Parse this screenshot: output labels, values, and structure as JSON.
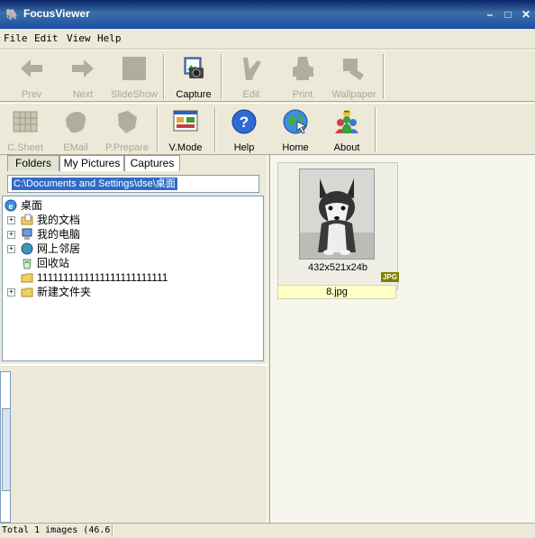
{
  "window": {
    "title": "FocusViewer",
    "min_label": "–",
    "max_label": "□",
    "close_label": "✕"
  },
  "menu": [
    "File",
    "Edit",
    "View",
    "Help"
  ],
  "toolbar1": [
    {
      "label": "Prev",
      "icon": "arrow-left-icon",
      "enabled": false
    },
    {
      "label": "Next",
      "icon": "arrow-right-icon",
      "enabled": false
    },
    {
      "label": "SlideShow",
      "icon": "slideshow-icon",
      "enabled": false
    },
    {
      "label": "Capture",
      "icon": "camera-icon",
      "enabled": true
    },
    {
      "label": "Edit",
      "icon": "paint-brush-icon",
      "enabled": false
    },
    {
      "label": "Print",
      "icon": "printer-icon",
      "enabled": false
    },
    {
      "label": "Wallpaper",
      "icon": "wallpaper-icon",
      "enabled": false
    }
  ],
  "toolbar2": [
    {
      "label": "C.Sheet",
      "icon": "contact-sheet-icon",
      "enabled": false
    },
    {
      "label": "EMail",
      "icon": "email-icon",
      "enabled": false
    },
    {
      "label": "P.Prepare",
      "icon": "print-prepare-icon",
      "enabled": false
    },
    {
      "label": "V.Mode",
      "icon": "view-mode-icon",
      "enabled": true
    },
    {
      "label": "Help",
      "icon": "help-icon",
      "enabled": true
    },
    {
      "label": "Home",
      "icon": "home-globe-icon",
      "enabled": true
    },
    {
      "label": "About",
      "icon": "about-icon",
      "enabled": true
    }
  ],
  "tabs": [
    "Folders",
    "My Pictures",
    "Captures"
  ],
  "path": "C:\\Documents and Settings\\dse\\桌面",
  "tree": [
    {
      "label": "桌面",
      "icon": "desktop-icon"
    },
    {
      "label": "我的文档",
      "icon": "my-documents-icon",
      "expander": "+"
    },
    {
      "label": "我的电脑",
      "icon": "my-computer-icon",
      "expander": "+"
    },
    {
      "label": "网上邻居",
      "icon": "network-icon",
      "expander": "+"
    },
    {
      "label": "回收站",
      "icon": "recycle-bin-icon"
    },
    {
      "label": "1111111111111111111111111",
      "icon": "folder-icon"
    },
    {
      "label": "新建文件夹",
      "icon": "folder-icon",
      "expander": "+"
    }
  ],
  "thumbnail": {
    "dims": "432x521x24b",
    "badge": "JPG",
    "name": "8.jpg"
  },
  "status": "Total 1 images (46.6"
}
